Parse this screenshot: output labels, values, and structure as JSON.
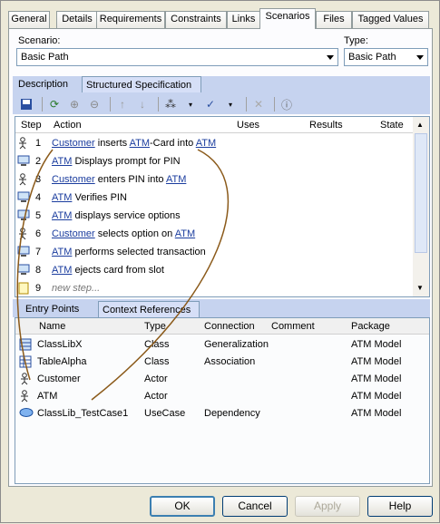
{
  "tabs": [
    "General",
    "Details",
    "Requirements",
    "Constraints",
    "Links",
    "Scenarios",
    "Files",
    "Tagged Values"
  ],
  "active_tab": "Scenarios",
  "scenario": {
    "label": "Scenario:",
    "value": "Basic Path"
  },
  "type": {
    "label": "Type:",
    "value": "Basic Path"
  },
  "subtabs": [
    "Description",
    "Structured Specification"
  ],
  "steps": {
    "headers": {
      "step": "Step",
      "action": "Action",
      "uses": "Uses",
      "results": "Results",
      "state": "State"
    },
    "rows": [
      {
        "n": "1",
        "icon": "actor",
        "parts": [
          [
            "Customer",
            true
          ],
          [
            " inserts ",
            false
          ],
          [
            "ATM",
            true
          ],
          [
            "-Card into ",
            false
          ],
          [
            "ATM",
            true
          ]
        ]
      },
      {
        "n": "2",
        "icon": "system",
        "parts": [
          [
            "ATM",
            true
          ],
          [
            " Displays prompt for PIN",
            false
          ]
        ]
      },
      {
        "n": "3",
        "icon": "actor",
        "parts": [
          [
            "Customer",
            true
          ],
          [
            " enters PIN into ",
            false
          ],
          [
            "ATM",
            true
          ]
        ]
      },
      {
        "n": "4",
        "icon": "system",
        "parts": [
          [
            "ATM",
            true
          ],
          [
            " Verifies PIN",
            false
          ]
        ]
      },
      {
        "n": "5",
        "icon": "system",
        "parts": [
          [
            "ATM",
            true
          ],
          [
            " displays service options",
            false
          ]
        ]
      },
      {
        "n": "6",
        "icon": "actor",
        "parts": [
          [
            "Customer",
            true
          ],
          [
            " selects option on ",
            false
          ],
          [
            "ATM",
            true
          ]
        ]
      },
      {
        "n": "7",
        "icon": "system",
        "parts": [
          [
            "ATM",
            true
          ],
          [
            " performs selected transaction",
            false
          ]
        ]
      },
      {
        "n": "8",
        "icon": "system",
        "parts": [
          [
            "ATM",
            true
          ],
          [
            " ejects card from slot",
            false
          ]
        ]
      },
      {
        "n": "9",
        "icon": "new",
        "parts": [
          [
            "new step...",
            false
          ]
        ]
      }
    ]
  },
  "ref_tabs": [
    "Entry Points",
    "Context References"
  ],
  "refs": {
    "headers": {
      "name": "Name",
      "type": "Type",
      "connection": "Connection",
      "comment": "Comment",
      "package": "Package"
    },
    "rows": [
      {
        "icon": "class",
        "name": "ClassLibX",
        "type": "Class",
        "connection": "Generalization",
        "comment": "",
        "package": "ATM Model"
      },
      {
        "icon": "table",
        "name": "TableAlpha",
        "type": "Class",
        "connection": "Association",
        "comment": "",
        "package": "ATM Model"
      },
      {
        "icon": "actor",
        "name": "Customer",
        "type": "Actor",
        "connection": "",
        "comment": "",
        "package": "ATM Model"
      },
      {
        "icon": "actor",
        "name": "ATM",
        "type": "Actor",
        "connection": "",
        "comment": "",
        "package": "ATM Model"
      },
      {
        "icon": "usecase",
        "name": "ClassLib_TestCase1",
        "type": "UseCase",
        "connection": "Dependency",
        "comment": "",
        "package": "ATM Model"
      }
    ]
  },
  "buttons": {
    "ok": "OK",
    "cancel": "Cancel",
    "apply": "Apply",
    "help": "Help"
  }
}
